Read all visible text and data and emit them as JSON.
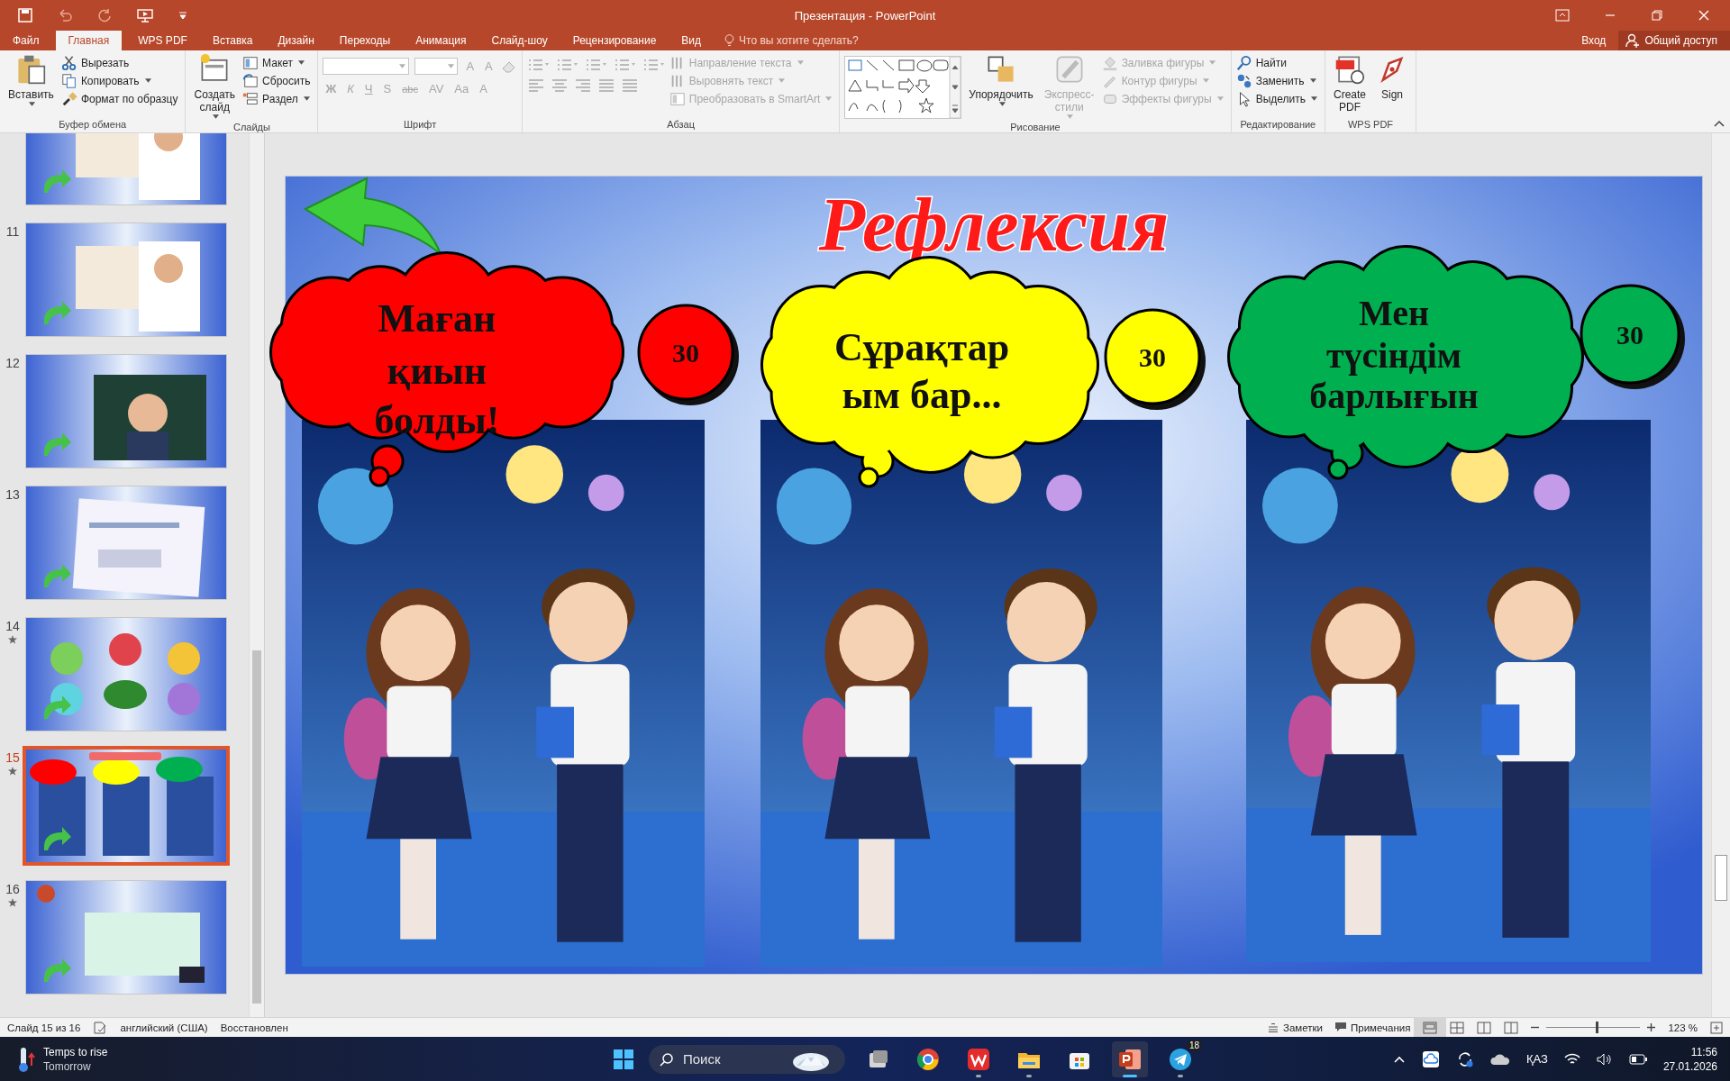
{
  "window": {
    "title": "Презентация - PowerPoint"
  },
  "menu_tabs": [
    {
      "label": "Файл",
      "selected": false
    },
    {
      "label": "Главная",
      "selected": true
    },
    {
      "label": "WPS PDF",
      "selected": false
    },
    {
      "label": "Вставка",
      "selected": false
    },
    {
      "label": "Дизайн",
      "selected": false
    },
    {
      "label": "Переходы",
      "selected": false
    },
    {
      "label": "Анимация",
      "selected": false
    },
    {
      "label": "Слайд-шоу",
      "selected": false
    },
    {
      "label": "Рецензирование",
      "selected": false
    },
    {
      "label": "Вид",
      "selected": false
    }
  ],
  "tell_me": {
    "placeholder": "Что вы хотите сделать?"
  },
  "account": {
    "sign_in": "Вход",
    "share": "Общий доступ"
  },
  "ribbon_groups": [
    {
      "name": "Буфер обмена",
      "parts": [
        {
          "kind": "large",
          "label": "Вставить",
          "disabled": false,
          "dropdown": true
        },
        {
          "kind": "stack",
          "items": [
            {
              "label": "Вырезать",
              "disabled": false,
              "dropdown": false
            },
            {
              "label": "Копировать",
              "disabled": false,
              "dropdown": true
            },
            {
              "label": "Формат по образцу",
              "disabled": false,
              "dropdown": false
            }
          ]
        }
      ]
    },
    {
      "name": "Слайды",
      "parts": [
        {
          "kind": "large",
          "label": "Создать слайд",
          "disabled": false,
          "dropdown": true
        },
        {
          "kind": "stack",
          "items": [
            {
              "label": "Макет",
              "disabled": false,
              "dropdown": true
            },
            {
              "label": "Сбросить",
              "disabled": false,
              "dropdown": false
            },
            {
              "label": "Раздел",
              "disabled": false,
              "dropdown": true
            }
          ]
        }
      ]
    },
    {
      "name": "Шрифт",
      "parts": [
        {
          "kind": "font",
          "row1": [
            {
              "label": "A",
              "disabled": true
            },
            {
              "label": "A",
              "disabled": true
            }
          ],
          "row2": [
            {
              "label": "Ж",
              "disabled": true
            },
            {
              "label": "К",
              "disabled": true
            },
            {
              "label": "Ч",
              "disabled": true
            },
            {
              "label": "S",
              "disabled": true
            },
            {
              "label": "abc",
              "disabled": true
            },
            {
              "label": "AV",
              "disabled": true
            },
            {
              "label": "Aa",
              "disabled": true
            },
            {
              "label": "A",
              "disabled": true
            }
          ]
        }
      ]
    },
    {
      "name": "Абзац",
      "parts": [
        {
          "kind": "paragraph_tools"
        },
        {
          "kind": "stack",
          "items": [
            {
              "label": "Направление текста",
              "disabled": true,
              "dropdown": true
            },
            {
              "label": "Выровнять текст",
              "disabled": true,
              "dropdown": true
            },
            {
              "label": "Преобразовать в SmartArt",
              "disabled": true,
              "dropdown": true
            }
          ]
        }
      ]
    },
    {
      "name": "Рисование",
      "parts": [
        {
          "kind": "gallery"
        },
        {
          "kind": "large",
          "label": "Упорядочить",
          "disabled": false,
          "dropdown": true
        },
        {
          "kind": "large",
          "label": "Экспресс-стили",
          "disabled": true,
          "dropdown": true
        },
        {
          "kind": "stack",
          "items": [
            {
              "label": "Заливка фигуры",
              "disabled": true,
              "dropdown": true
            },
            {
              "label": "Контур фигуры",
              "disabled": true,
              "dropdown": true
            },
            {
              "label": "Эффекты фигуры",
              "disabled": true,
              "dropdown": true
            }
          ]
        }
      ]
    },
    {
      "name": "Редактирование",
      "parts": [
        {
          "kind": "stack",
          "items": [
            {
              "label": "Найти",
              "disabled": false,
              "dropdown": false
            },
            {
              "label": "Заменить",
              "disabled": false,
              "dropdown": true
            },
            {
              "label": "Выделить",
              "disabled": false,
              "dropdown": true
            }
          ]
        }
      ]
    },
    {
      "name": "WPS PDF",
      "parts": [
        {
          "kind": "large",
          "label": "Create PDF",
          "disabled": false,
          "dropdown": false
        },
        {
          "kind": "large",
          "label": "Sign",
          "disabled": false,
          "dropdown": false
        }
      ]
    }
  ],
  "thumbnails": [
    {
      "starred": false,
      "selected": false
    },
    {
      "number": "11",
      "starred": false,
      "selected": false
    },
    {
      "number": "12",
      "starred": false,
      "selected": false
    },
    {
      "number": "13",
      "starred": false,
      "selected": false
    },
    {
      "number": "14",
      "starred": true,
      "selected": false
    },
    {
      "number": "15",
      "starred": true,
      "selected": true
    },
    {
      "number": "16",
      "starred": true,
      "selected": false
    }
  ],
  "slide": {
    "title": "Рефлексия",
    "bubbles": [
      {
        "lines": [
          "Маған",
          "қиын",
          "болды!"
        ],
        "color": "#ff0000",
        "count": "30"
      },
      {
        "lines": [
          "Сұрақтар",
          "ым бар..."
        ],
        "color": "#ffff00",
        "count": "30"
      },
      {
        "lines": [
          "Мен",
          "түсіндім",
          "барлығын"
        ],
        "color": "#00b050",
        "count": "30"
      }
    ]
  },
  "status_bar": {
    "slide_info": "Слайд 15 из 16",
    "language": "английский (США)",
    "state": "Восстановлен",
    "notes": "Заметки",
    "comments": "Примечания",
    "views": [
      {
        "selected": true
      },
      {
        "selected": false
      },
      {
        "selected": false
      },
      {
        "selected": false
      }
    ],
    "zoom": {
      "level": 0.53,
      "reading": "123 %"
    }
  },
  "taskbar": {
    "weather": {
      "title": "Temps to rise",
      "subtitle": "Tomorrow"
    },
    "search": {
      "placeholder": "Поиск"
    },
    "apps": [
      {
        "running": false,
        "selected": false
      },
      {
        "running": false,
        "selected": false
      },
      {
        "running": true,
        "selected": false
      },
      {
        "running": true,
        "selected": false
      },
      {
        "running": false,
        "selected": false
      },
      {
        "running": true,
        "selected": true
      },
      {
        "running": true,
        "selected": false,
        "badge": "18"
      }
    ],
    "language": "ҚАЗ",
    "time": "11:56",
    "date": "27.01.2026"
  }
}
